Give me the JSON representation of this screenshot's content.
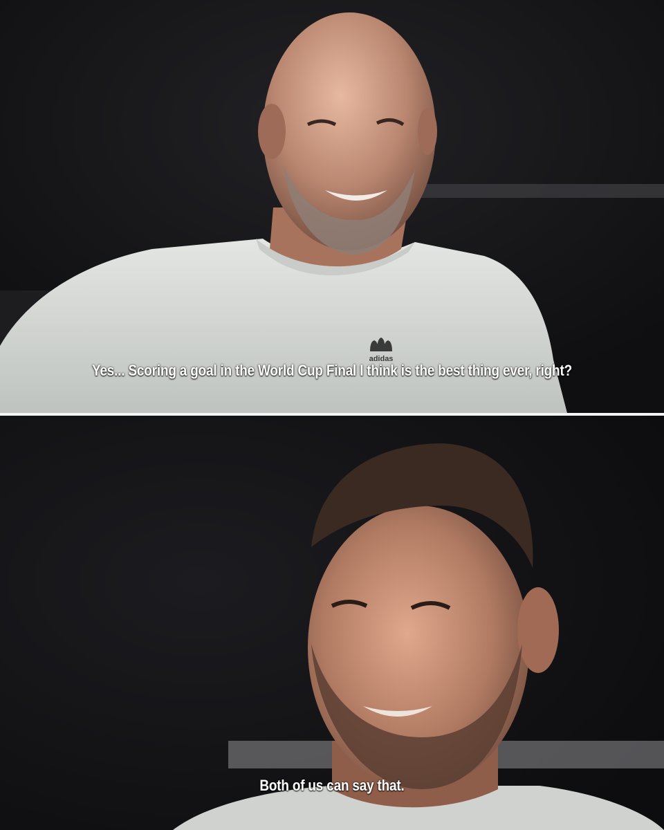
{
  "panels": [
    {
      "caption": "Yes... Scoring a goal in the World Cup Final I think is the best thing ever, right?",
      "shirt_logo_text": "adidas"
    },
    {
      "caption": "Both of us can say that."
    }
  ],
  "colors": {
    "background": "#141416",
    "shirt": "#d9dcd8",
    "skin": "#b88670",
    "caption": "#ffffff",
    "divider": "#f4f4f4"
  }
}
